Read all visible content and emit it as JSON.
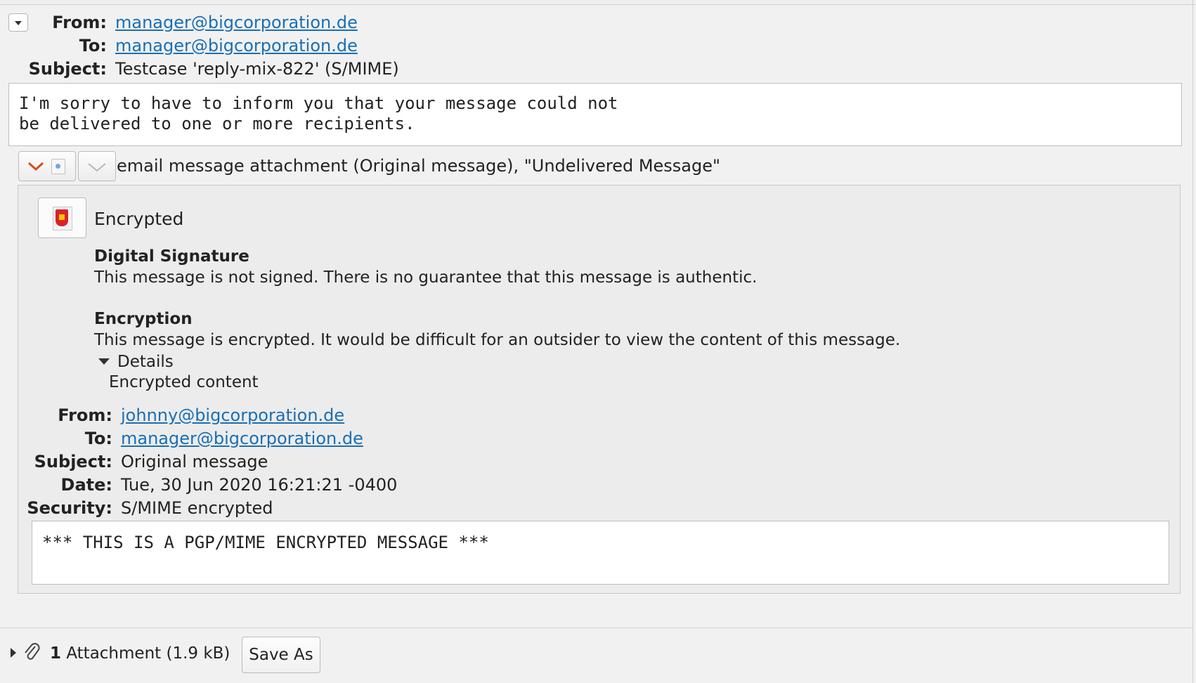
{
  "header": {
    "from_label": "From:",
    "from_value": "manager@bigcorporation.de",
    "to_label": "To:",
    "to_value": "manager@bigcorporation.de",
    "subject_label": "Subject:",
    "subject_value": "Testcase 'reply-mix-822' (S/MIME)"
  },
  "body": {
    "line1": "I'm sorry to have to inform you that your message could not",
    "line2": "be delivered to one or more recipients."
  },
  "attachment_header": {
    "label": "email message attachment (Original message), \"Undelivered Message\""
  },
  "security": {
    "status": "Encrypted",
    "signature_title": "Digital Signature",
    "signature_text": "This message is not signed. There is no guarantee that this message is authentic.",
    "encryption_title": "Encryption",
    "encryption_text": "This message is encrypted. It would be difficult for an outsider to view the content of this message.",
    "details_label": "Details",
    "details_text": "Encrypted content"
  },
  "original": {
    "from_label": "From:",
    "from_value": "johnny@bigcorporation.de",
    "to_label": "To:",
    "to_value": "manager@bigcorporation.de",
    "subject_label": "Subject:",
    "subject_value": "Original message",
    "date_label": "Date:",
    "date_value": "Tue, 30 Jun 2020 16:21:21 -0400",
    "security_label": "Security:",
    "security_value": "S/MIME encrypted",
    "body": "*** THIS IS A PGP/MIME ENCRYPTED MESSAGE ***"
  },
  "footer": {
    "count": "1",
    "attachment_text": "Attachment (1.9 kB)",
    "save_as": "Save As"
  },
  "colors": {
    "link": "#1a6fb4",
    "background": "#f1f1f1",
    "seal_red": "#d8232a",
    "seal_yellow": "#f4c300"
  }
}
